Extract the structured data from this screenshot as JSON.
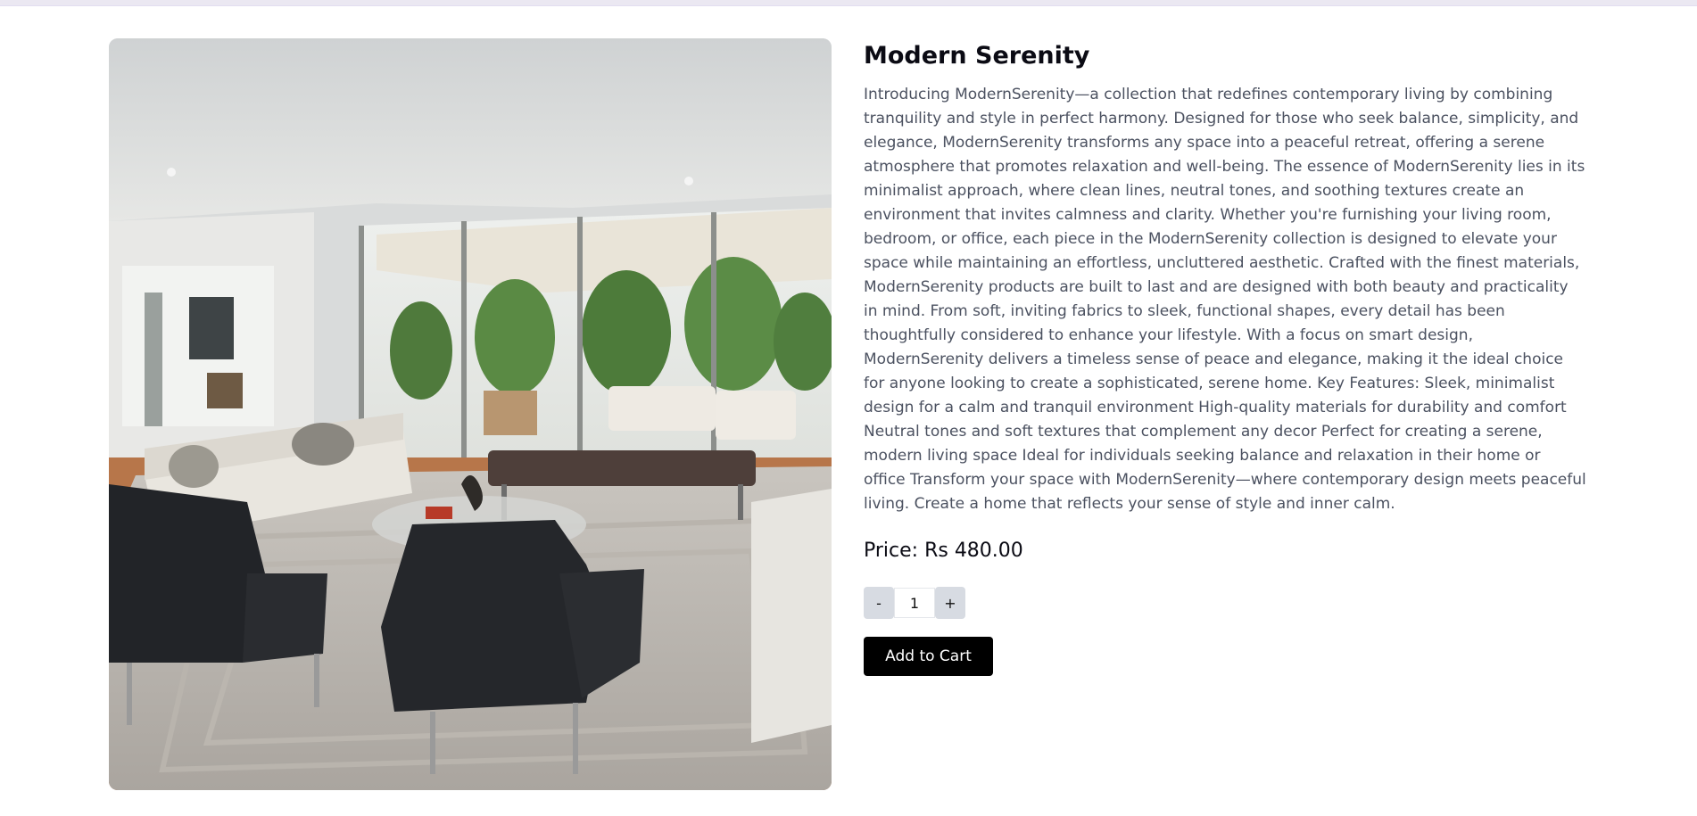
{
  "product": {
    "title": "Modern Serenity",
    "description": "Introducing ModernSerenity—a collection that redefines contemporary living by combining tranquility and style in perfect harmony. Designed for those who seek balance, simplicity, and elegance, ModernSerenity transforms any space into a peaceful retreat, offering a serene atmosphere that promotes relaxation and well-being. The essence of ModernSerenity lies in its minimalist approach, where clean lines, neutral tones, and soothing textures create an environment that invites calmness and clarity. Whether you're furnishing your living room, bedroom, or office, each piece in the ModernSerenity collection is designed to elevate your space while maintaining an effortless, uncluttered aesthetic. Crafted with the finest materials, ModernSerenity products are built to last and are designed with both beauty and practicality in mind. From soft, inviting fabrics to sleek, functional shapes, every detail has been thoughtfully considered to enhance your lifestyle. With a focus on smart design, ModernSerenity delivers a timeless sense of peace and elegance, making it the ideal choice for anyone looking to create a sophisticated, serene home. Key Features: Sleek, minimalist design for a calm and tranquil environment High-quality materials for durability and comfort Neutral tones and soft textures that complement any decor Perfect for creating a serene, modern living space Ideal for individuals seeking balance and relaxation in their home or office Transform your space with ModernSerenity—where contemporary design meets peaceful living. Create a home that reflects your sense of style and inner calm.",
    "price_label": "Price: Rs 480.00"
  },
  "quantity": {
    "decrement_label": "-",
    "value": "1",
    "increment_label": "+"
  },
  "cart": {
    "add_label": "Add to Cart"
  },
  "colors": {
    "button_bg": "#000000",
    "stepper_bg": "#d7dbe2",
    "title_text": "#0b0b14",
    "body_text": "#4b5160"
  }
}
